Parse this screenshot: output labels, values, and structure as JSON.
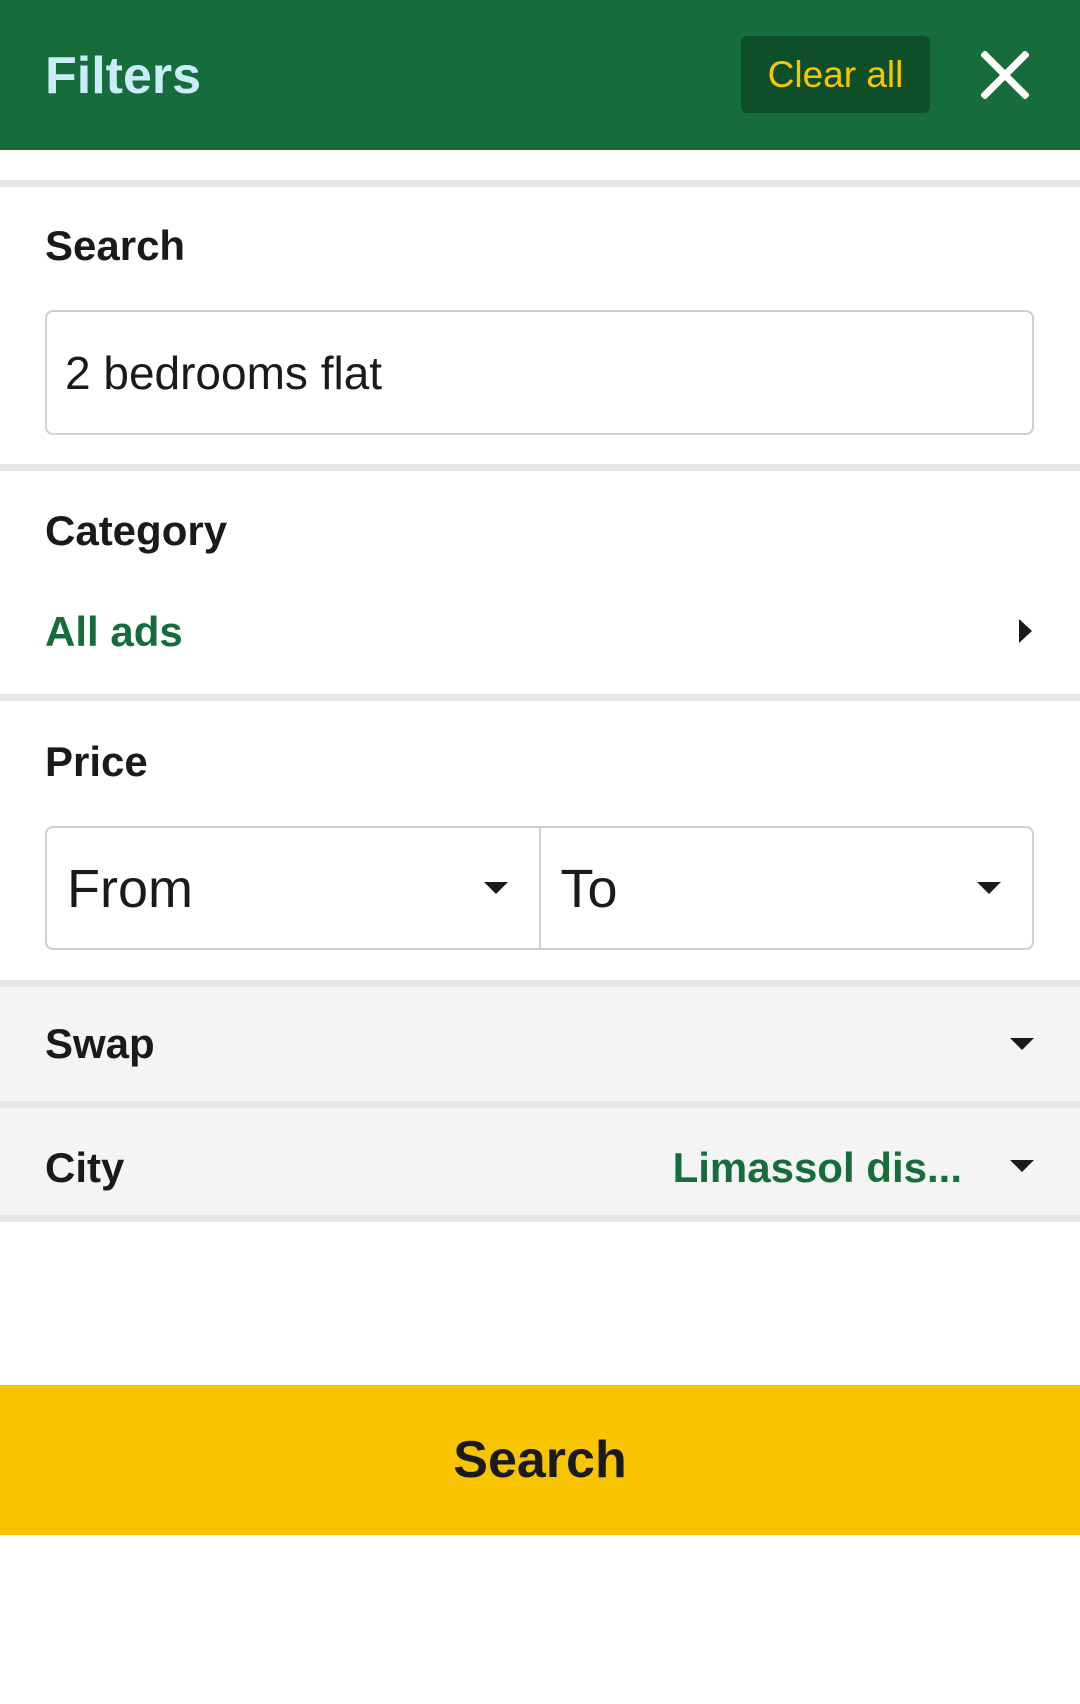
{
  "header": {
    "title": "Filters",
    "clear_all_label": "Clear all",
    "close_icon": "close-icon"
  },
  "search": {
    "label": "Search",
    "value": "2 bedrooms flat"
  },
  "category": {
    "label": "Category",
    "value": "All ads",
    "icon": "chevron-right-icon"
  },
  "price": {
    "label": "Price",
    "from_label": "From",
    "to_label": "To",
    "icon": "caret-down-icon"
  },
  "swap": {
    "label": "Swap"
  },
  "city": {
    "label": "City",
    "value": "Limassol dis..."
  },
  "search_button": {
    "label": "Search"
  },
  "colors": {
    "header_bg": "#166c3b",
    "title_text": "#c9ecf8",
    "clear_all_bg": "#0e4f2a",
    "clear_all_text": "#f6c600",
    "accent_green": "#166c3b",
    "search_button_bg": "#f8c400",
    "row_bg": "#f4f4f4"
  }
}
